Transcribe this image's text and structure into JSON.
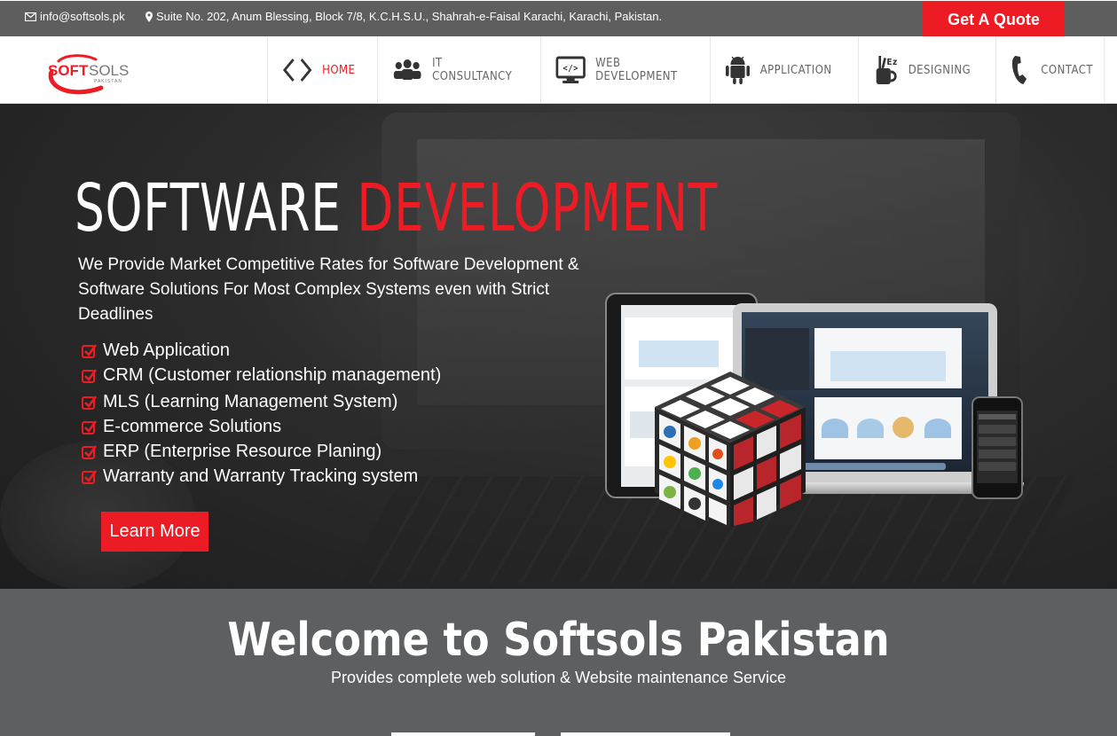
{
  "topbar": {
    "email": "info@softsols.pk",
    "address": "Suite No. 202, Anum Blessing, Block 7/8, K.C.H.S.U., Shahrah-e-Faisal Karachi, Karachi, Pakistan.",
    "quote_button": "Get A Quote"
  },
  "logo": {
    "main_soft": "SOFT",
    "main_sols": "SOLS",
    "sub": "PAKISTAN"
  },
  "nav": {
    "items": [
      {
        "label": "HOME",
        "icon": "code-brackets-icon"
      },
      {
        "label": "IT CONSULTANCY",
        "icon": "users-icon"
      },
      {
        "label": "WEB DEVELOPMENT",
        "icon": "monitor-code-icon"
      },
      {
        "label": "APPLICATION",
        "icon": "android-icon"
      },
      {
        "label": "DESIGNING",
        "icon": "design-tools-icon"
      },
      {
        "label": "CONTACT",
        "icon": "phone-icon"
      }
    ]
  },
  "hero": {
    "title_white": "SOFTWARE",
    "title_red": "DEVELOPMENT",
    "description": "We Provide Market Competitive Rates for Software Development & Software Solutions For Most Complex Systems even with Strict Deadlines",
    "features": [
      "Web Application",
      "CRM (Customer relationship management)",
      "MLS (Learning Management System)",
      "E-commerce Solutions",
      "ERP (Enterprise Resource Planing)",
      "Warranty and Warranty Tracking system"
    ],
    "learn_more": "Learn More"
  },
  "welcome": {
    "title": "Welcome to Softsols Pakistan",
    "subtitle": "Provides complete web solution & Website maintenance Service"
  },
  "colors": {
    "accent": "#ed1c24",
    "topbar": "#5e5e5e",
    "welcome_bg": "#5e5f61"
  }
}
